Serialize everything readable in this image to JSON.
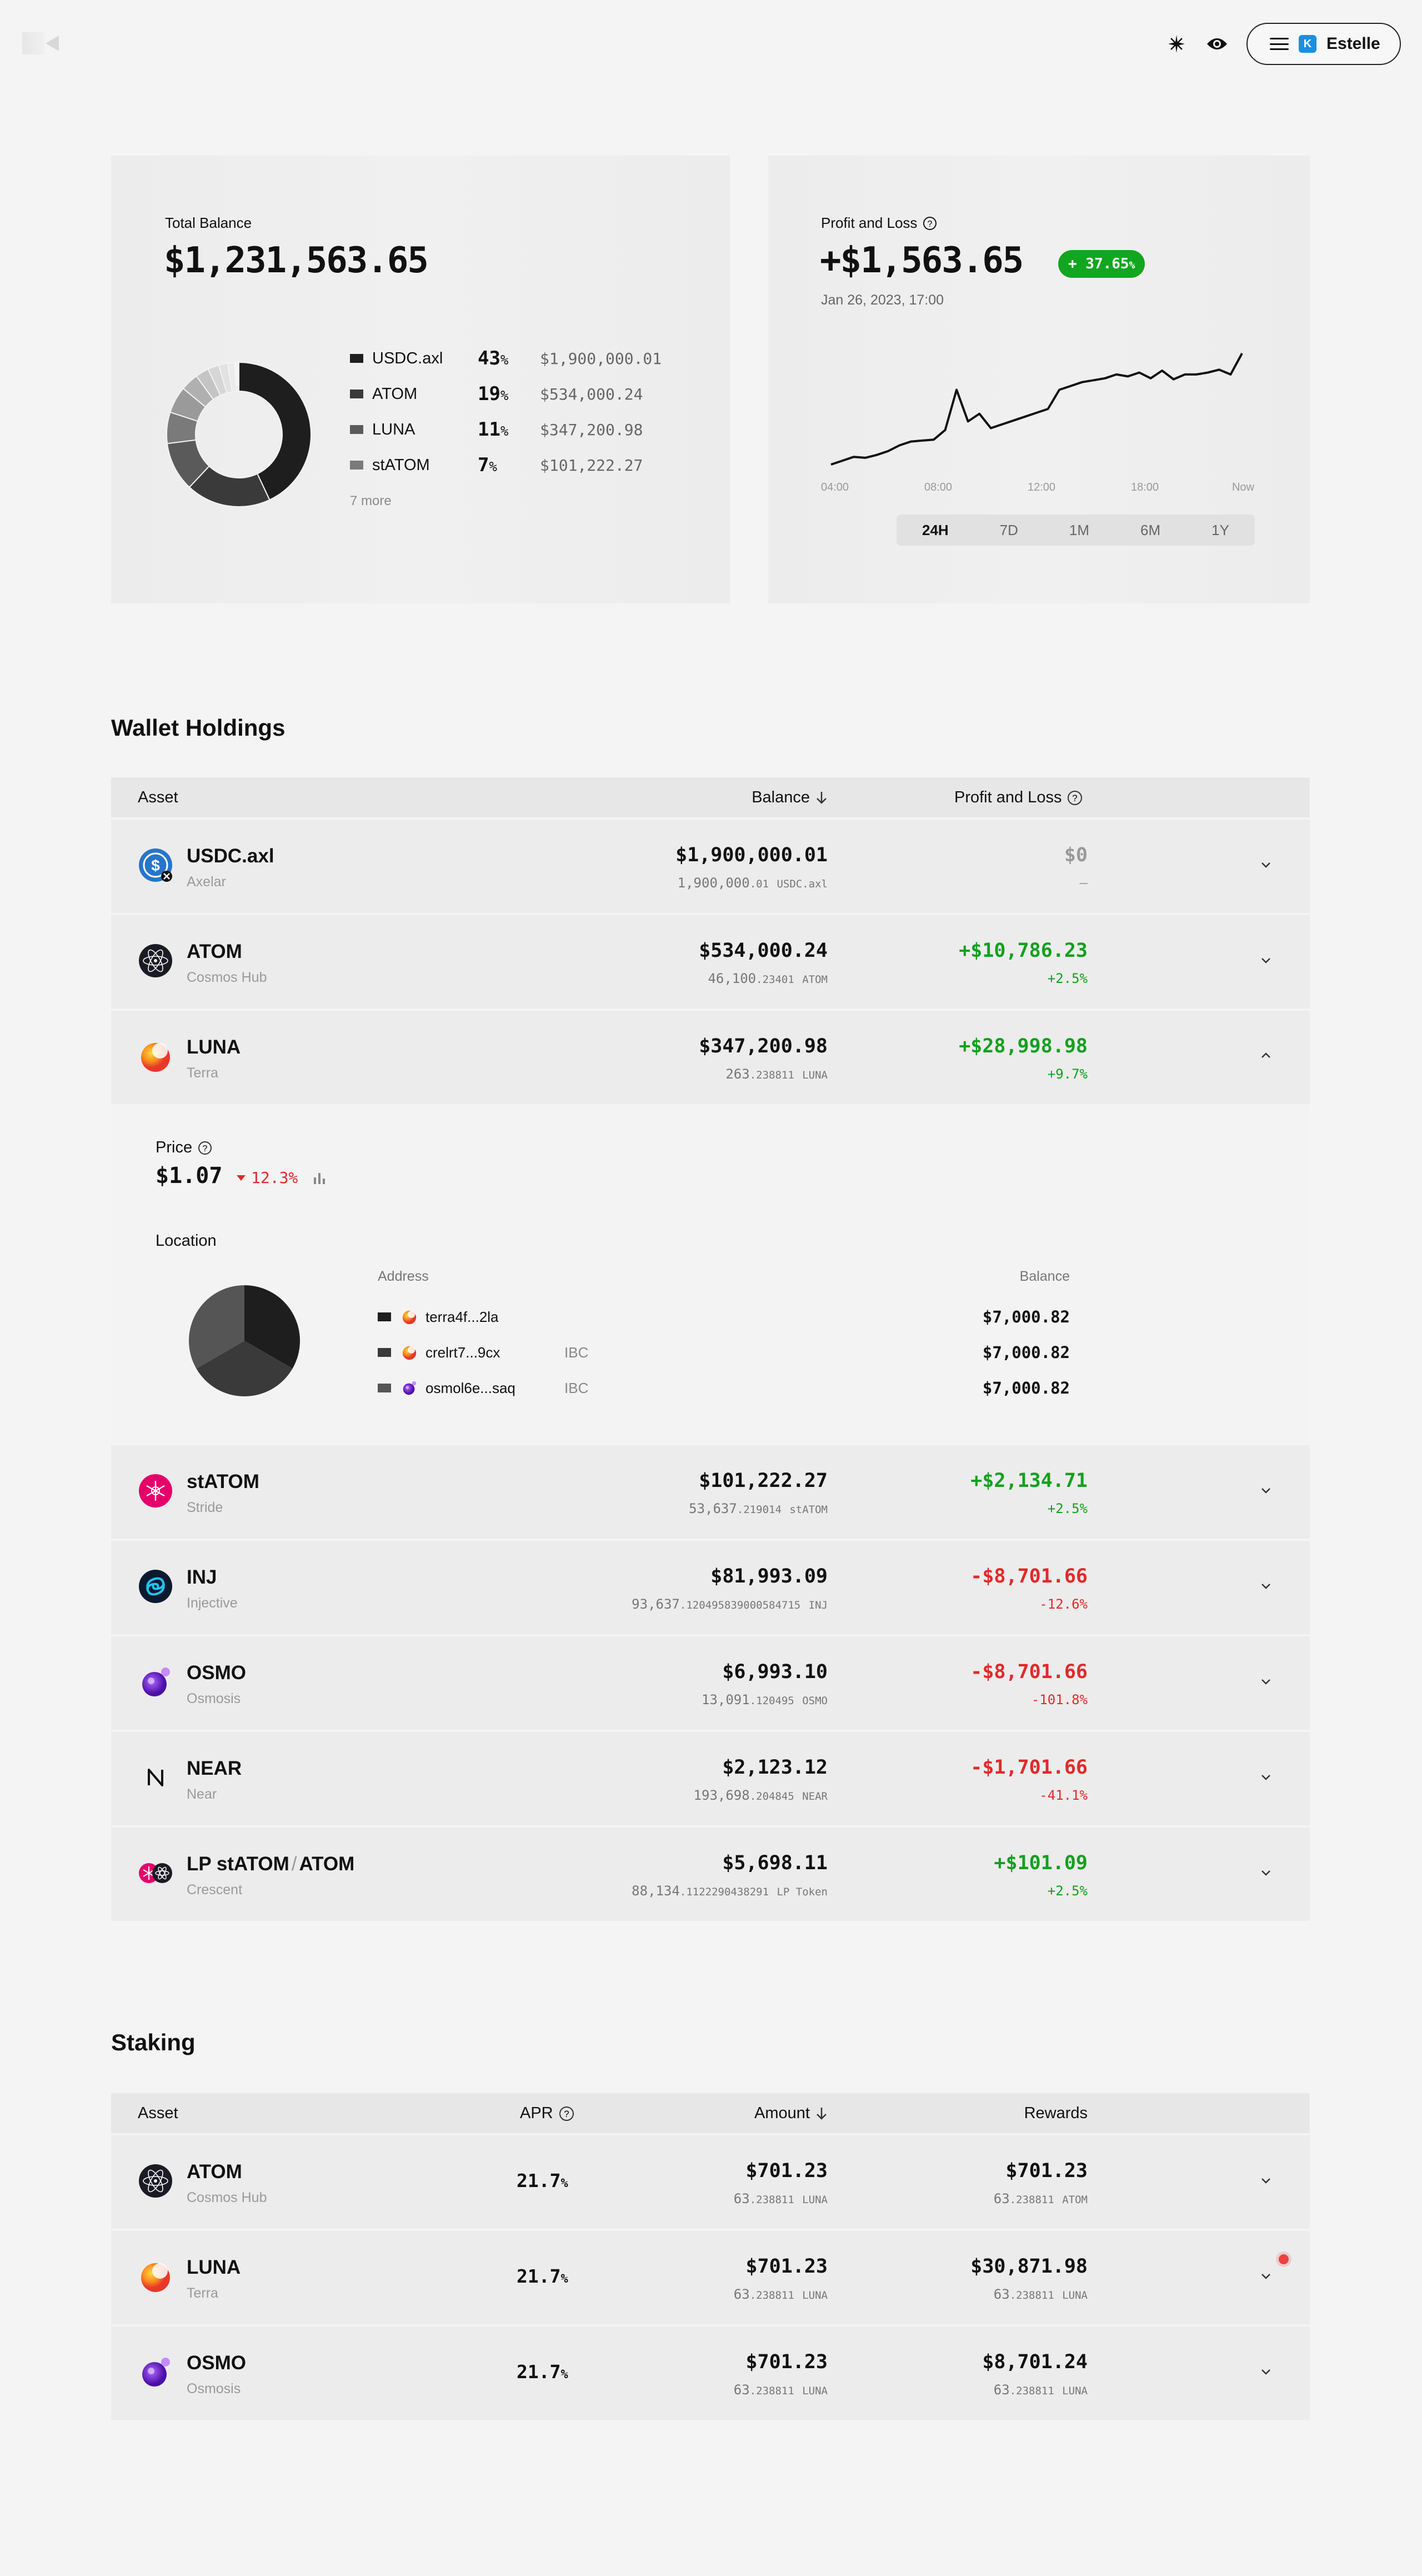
{
  "header": {
    "user_initial": "K",
    "user_name": "Estelle",
    "icons": [
      "logo-icon",
      "sparkle-icon",
      "eye-icon",
      "menu-icon"
    ]
  },
  "balance_card": {
    "label": "Total Balance",
    "value": "$1,231,563.65",
    "legend": [
      {
        "name": "USDC.axl",
        "percent": "43",
        "value": "$1,900,000.01",
        "color": "#1e1e1e"
      },
      {
        "name": "ATOM",
        "percent": "19",
        "value": "$534,000.24",
        "color": "#3a3a3a"
      },
      {
        "name": "LUNA",
        "percent": "11",
        "value": "$347,200.98",
        "color": "#5a5a5a"
      },
      {
        "name": "stATOM",
        "percent": "7",
        "value": "$101,222.27",
        "color": "#7a7a7a"
      }
    ],
    "more": "7 more",
    "percent_sign": "%"
  },
  "pnl_card": {
    "label": "Profit and Loss",
    "value": "+$1,563.65",
    "badge": "+ 37.65",
    "badge_pct": "%",
    "date": "Jan 26, 2023, 17:00",
    "x_ticks": [
      "04:00",
      "08:00",
      "12:00",
      "18:00",
      "Now"
    ],
    "ranges": [
      "24H",
      "7D",
      "1M",
      "6M",
      "1Y"
    ],
    "selected_range": "24H"
  },
  "chart_data": {
    "type": "line",
    "x_ticks": [
      "04:00",
      "08:00",
      "12:00",
      "18:00",
      "Now"
    ],
    "values": [
      10,
      14,
      18,
      17,
      20,
      24,
      30,
      34,
      35,
      36,
      46,
      88,
      55,
      63,
      48,
      52,
      56,
      60,
      64,
      68,
      88,
      92,
      96,
      98,
      100,
      104,
      102,
      106,
      100,
      108,
      99,
      104,
      104,
      106,
      109,
      104,
      126
    ],
    "grid": false
  },
  "holdings": {
    "title": "Wallet Holdings",
    "headers": {
      "asset": "Asset",
      "balance": "Balance",
      "pnl": "Profit and Loss"
    },
    "rows": [
      {
        "name": "USDC.axl",
        "chain": "Axelar",
        "usd": "$1,900,000.01",
        "amt_int": "1,900,000",
        "amt_dec": ".01",
        "unit": "USDC.axl",
        "pnl": "$0",
        "pnl_pct": "—",
        "trend": "flat"
      },
      {
        "name": "ATOM",
        "chain": "Cosmos Hub",
        "usd": "$534,000.24",
        "amt_int": "46,100",
        "amt_dec": ".23401",
        "unit": "ATOM",
        "pnl": "+$10,786.23",
        "pnl_pct": "+2.5%",
        "trend": "up"
      },
      {
        "name": "LUNA",
        "chain": "Terra",
        "usd": "$347,200.98",
        "amt_int": "263",
        "amt_dec": ".238811",
        "unit": "LUNA",
        "pnl": "+$28,998.98",
        "pnl_pct": "+9.7%",
        "trend": "up"
      },
      {
        "name": "stATOM",
        "chain": "Stride",
        "usd": "$101,222.27",
        "amt_int": "53,637",
        "amt_dec": ".219014",
        "unit": "stATOM",
        "pnl": "+$2,134.71",
        "pnl_pct": "+2.5%",
        "trend": "up"
      },
      {
        "name": "INJ",
        "chain": "Injective",
        "usd": "$81,993.09",
        "amt_int": "93,637",
        "amt_dec": ".120495839000584715",
        "unit": "INJ",
        "pnl": "-$8,701.66",
        "pnl_pct": "-12.6%",
        "trend": "down"
      },
      {
        "name": "OSMO",
        "chain": "Osmosis",
        "usd": "$6,993.10",
        "amt_int": "13,091",
        "amt_dec": ".120495",
        "unit": "OSMO",
        "pnl": "-$8,701.66",
        "pnl_pct": "-101.8%",
        "trend": "down"
      },
      {
        "name": "NEAR",
        "chain": "Near",
        "usd": "$2,123.12",
        "amt_int": "193,698",
        "amt_dec": ".204845",
        "unit": "NEAR",
        "pnl": "-$1,701.66",
        "pnl_pct": "-41.1%",
        "trend": "down"
      },
      {
        "name": "LP stATOM",
        "name_sep": "/",
        "name_b": "ATOM",
        "chain": "Crescent",
        "usd": "$5,698.11",
        "amt_int": "88,134",
        "amt_dec": ".1122290438291",
        "unit": "LP Token",
        "pnl": "+$101.09",
        "pnl_pct": "+2.5%",
        "trend": "up"
      }
    ],
    "expanded": {
      "price_label": "Price",
      "price": "$1.07",
      "change": "12.3%",
      "location_label": "Location",
      "address_header": "Address",
      "balance_header": "Balance",
      "locations": [
        {
          "address": "terra4f...2la",
          "tag": "",
          "balance": "$7,000.82",
          "color": "#1e1e1e"
        },
        {
          "address": "crelrt7...9cx",
          "tag": "IBC",
          "balance": "$7,000.82",
          "color": "#3a3a3a"
        },
        {
          "address": "osmol6e...saq",
          "tag": "IBC",
          "balance": "$7,000.82",
          "color": "#555555"
        }
      ]
    }
  },
  "staking": {
    "title": "Staking",
    "headers": {
      "asset": "Asset",
      "apr": "APR",
      "amount": "Amount",
      "rewards": "Rewards"
    },
    "rows": [
      {
        "name": "ATOM",
        "chain": "Cosmos Hub",
        "apr": "21.7",
        "apr_pct": "%",
        "amount": "$701.23",
        "amt_int": "63",
        "amt_dec": ".238811",
        "amt_unit": "LUNA",
        "reward": "$701.23",
        "rw_int": "63",
        "rw_dec": ".238811",
        "rw_unit": "ATOM"
      },
      {
        "name": "LUNA",
        "chain": "Terra",
        "apr": "21.7",
        "apr_pct": "%",
        "amount": "$701.23",
        "amt_int": "63",
        "amt_dec": ".238811",
        "amt_unit": "LUNA",
        "reward": "$30,871.98",
        "rw_int": "63",
        "rw_dec": ".238811",
        "rw_unit": "LUNA"
      },
      {
        "name": "OSMO",
        "chain": "Osmosis",
        "apr": "21.7",
        "apr_pct": "%",
        "amount": "$701.23",
        "amt_int": "63",
        "amt_dec": ".238811",
        "amt_unit": "LUNA",
        "reward": "$8,701.24",
        "rw_int": "63",
        "rw_dec": ".238811",
        "rw_unit": "LUNA"
      }
    ]
  }
}
